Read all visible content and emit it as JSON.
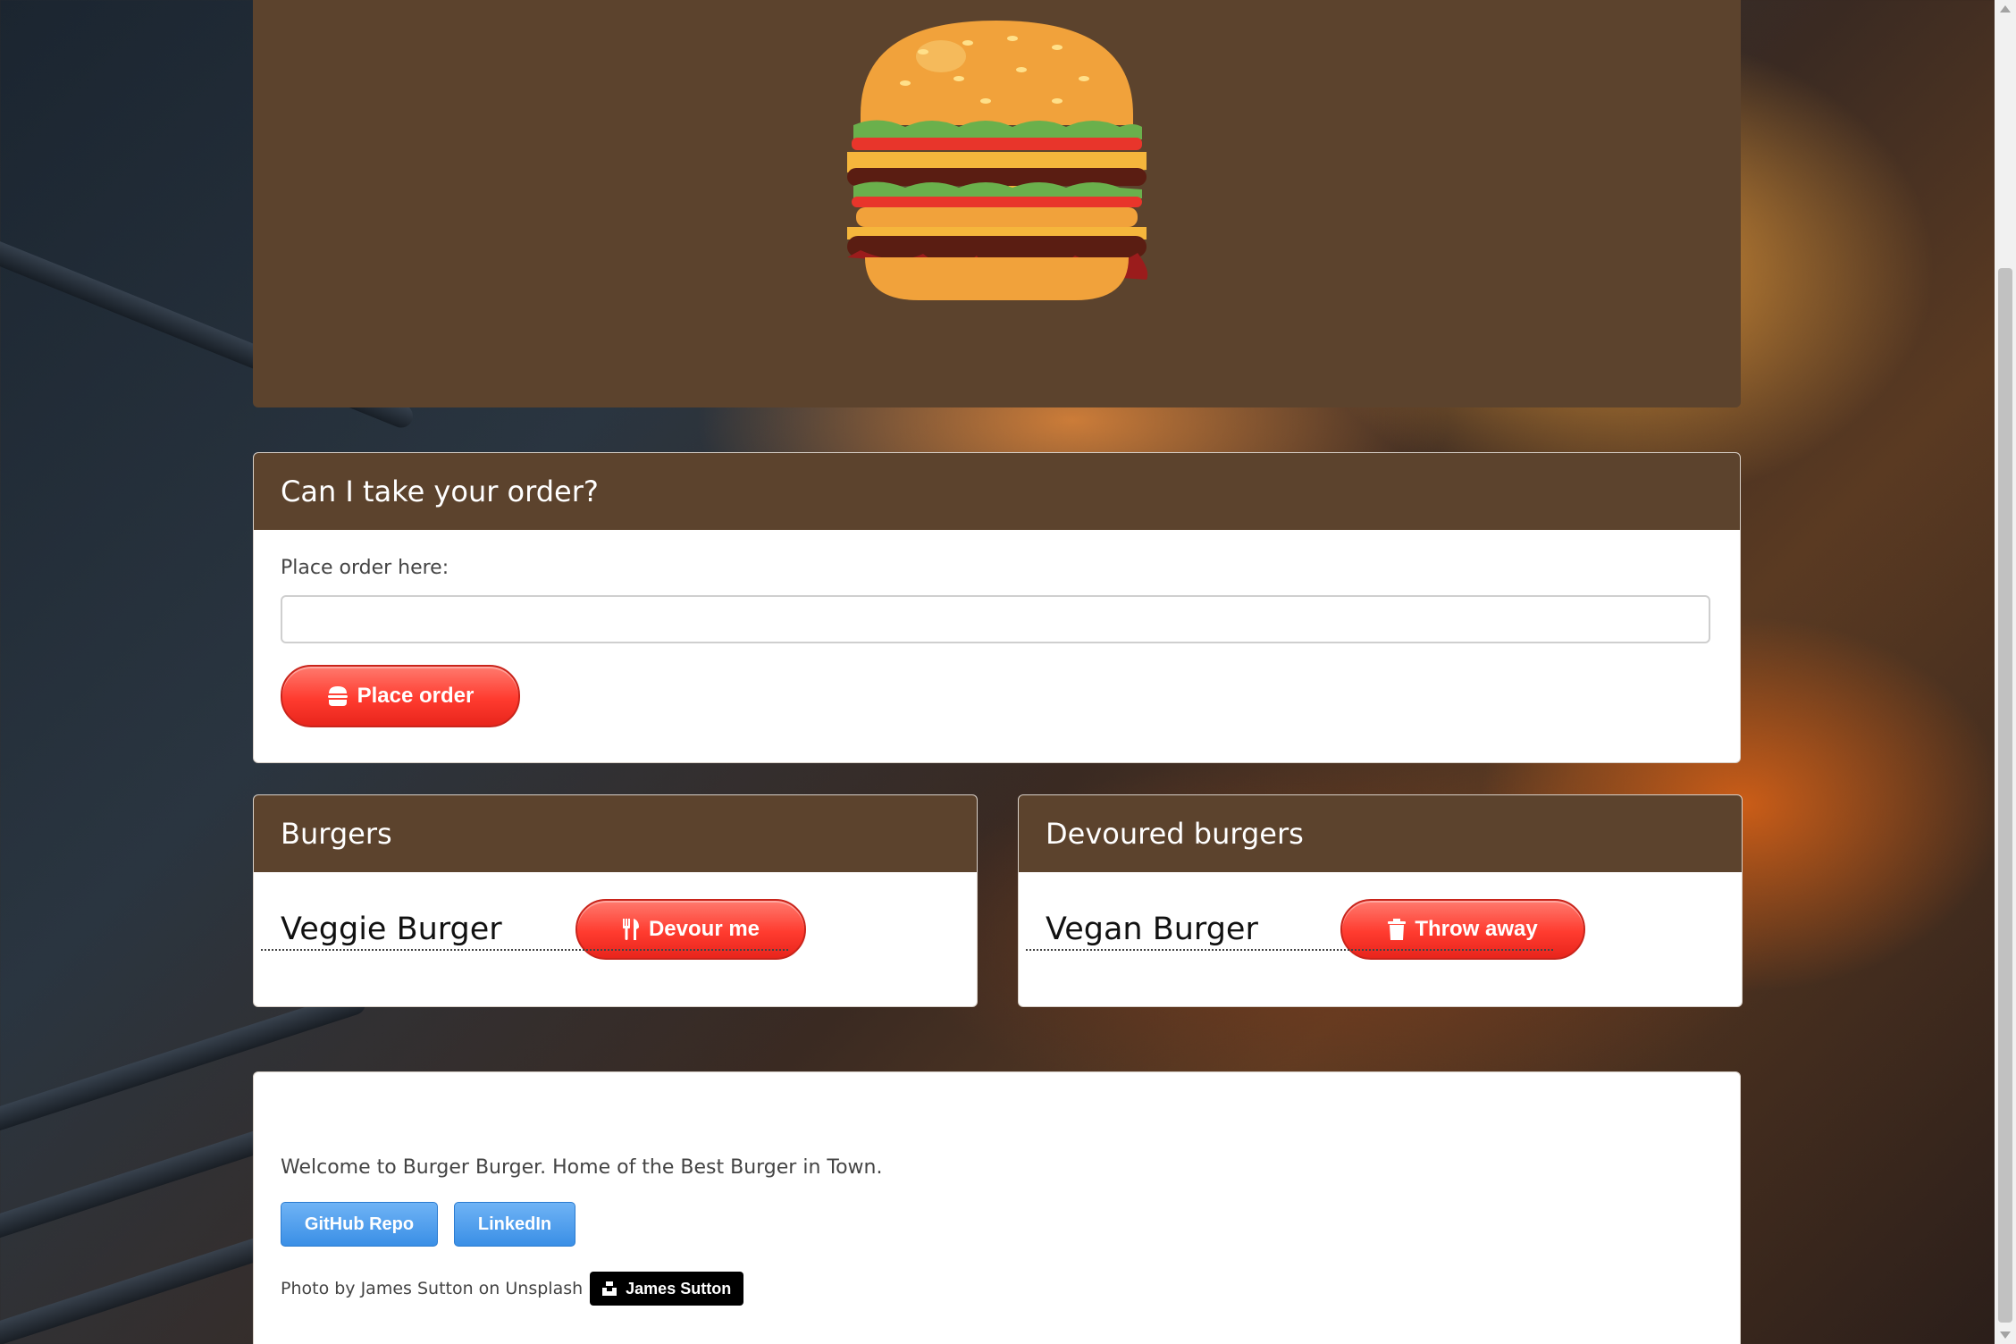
{
  "hero": {
    "logo_icon": "burger-logo-icon"
  },
  "order": {
    "header": "Can I take your order?",
    "label": "Place order here:",
    "input_value": "",
    "button_label": "Place order",
    "button_icon": "hamburger-icon"
  },
  "burgers": {
    "header": "Burgers",
    "items": [
      {
        "name": "Veggie Burger",
        "action": "Devour me",
        "action_icon": "utensils-icon"
      }
    ]
  },
  "devoured": {
    "header": "Devoured burgers",
    "items": [
      {
        "name": "Vegan Burger",
        "action": "Throw away",
        "action_icon": "trash-icon"
      }
    ]
  },
  "footer": {
    "welcome": "Welcome to Burger Burger. Home of the Best Burger in Town.",
    "github_label": "GitHub Repo",
    "linkedin_label": "LinkedIn",
    "credit_text": "Photo by James Sutton on Unsplash",
    "badge_label": "James Sutton",
    "badge_icon": "unsplash-icon"
  },
  "colors": {
    "brand_brown": "#5c432d",
    "button_red": "#ff3b2f",
    "button_blue": "#3a8fe6"
  }
}
